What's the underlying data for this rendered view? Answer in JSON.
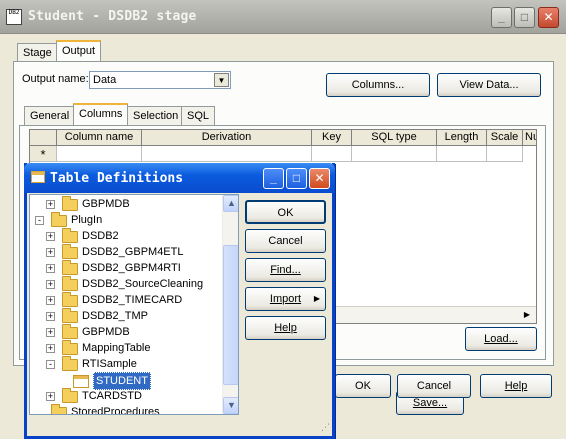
{
  "main_window": {
    "title": "Student - DSDB2 stage",
    "app_icon_text": "DB2",
    "minimize": "_",
    "maximize": "□",
    "close": "✕",
    "tabs": [
      {
        "label": "Stage"
      },
      {
        "label": "Output"
      }
    ],
    "output_name_label": "Output name:",
    "output_name_value": "Data",
    "columns_button": "Columns...",
    "view_data_button": "View Data...",
    "subtabs": [
      {
        "label": "General"
      },
      {
        "label": "Columns"
      },
      {
        "label": "Selection"
      },
      {
        "label": "SQL"
      }
    ],
    "grid": {
      "headers": [
        "",
        "Column name",
        "Derivation",
        "Key",
        "SQL type",
        "Length",
        "Scale",
        "Nu"
      ],
      "new_row_marker": "*"
    },
    "save_button": "Save...",
    "load_button": "Load...",
    "ok_button": "OK",
    "cancel_button": "Cancel",
    "help_button": "Help"
  },
  "table_definitions": {
    "title": "Table Definitions",
    "minimize": "_",
    "maximize": "□",
    "close": "✕",
    "tree": [
      {
        "label": "GBPMDB",
        "expander": "+",
        "icon": "folder",
        "indent": 1
      },
      {
        "label": "PlugIn",
        "expander": "-",
        "icon": "folder",
        "indent": 0
      },
      {
        "label": "DSDB2",
        "expander": "+",
        "icon": "folder",
        "indent": 1
      },
      {
        "label": "DSDB2_GBPM4ETL",
        "expander": "+",
        "icon": "folder",
        "indent": 1
      },
      {
        "label": "DSDB2_GBPM4RTI",
        "expander": "+",
        "icon": "folder",
        "indent": 1
      },
      {
        "label": "DSDB2_SourceCleaning",
        "expander": "+",
        "icon": "folder",
        "indent": 1
      },
      {
        "label": "DSDB2_TIMECARD",
        "expander": "+",
        "icon": "folder",
        "indent": 1
      },
      {
        "label": "DSDB2_TMP",
        "expander": "+",
        "icon": "folder",
        "indent": 1
      },
      {
        "label": "GBPMDB",
        "expander": "+",
        "icon": "folder",
        "indent": 1
      },
      {
        "label": "MappingTable",
        "expander": "+",
        "icon": "folder",
        "indent": 1
      },
      {
        "label": "RTISample",
        "expander": "-",
        "icon": "folder",
        "indent": 1
      },
      {
        "label": "STUDENT",
        "expander": "",
        "icon": "table",
        "indent": 2,
        "selected": true
      },
      {
        "label": "TCARDSTD",
        "expander": "+",
        "icon": "folder",
        "indent": 1
      },
      {
        "label": "StoredProcedures",
        "expander": "",
        "icon": "folder",
        "indent": 0
      }
    ],
    "buttons": {
      "ok": "OK",
      "cancel": "Cancel",
      "find": "Find...",
      "import": "Import",
      "import_arrow": "▶",
      "help": "Help"
    }
  }
}
